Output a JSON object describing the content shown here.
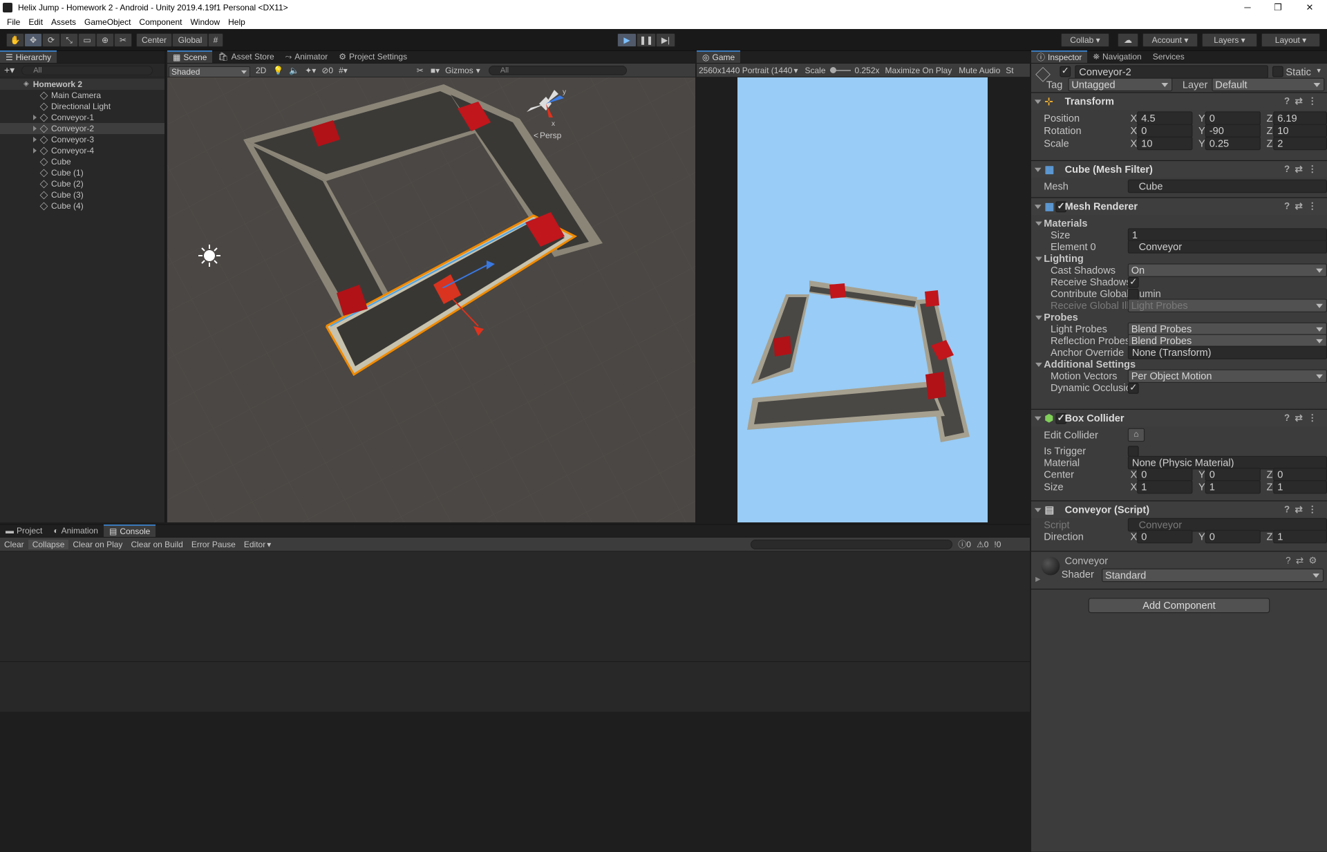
{
  "window": {
    "title": "Helix Jump - Homework 2 - Android - Unity 2019.4.19f1 Personal <DX11>",
    "minimize": "─",
    "maximize": "❐",
    "close": "✕"
  },
  "menu": [
    "File",
    "Edit",
    "Assets",
    "GameObject",
    "Component",
    "Window",
    "Help"
  ],
  "toolbar": {
    "pivot": "Center",
    "space": "Global",
    "collab": "Collab",
    "account": "Account",
    "layers": "Layers",
    "layout": "Layout"
  },
  "hierarchy": {
    "tab": "Hierarchy",
    "search_placeholder": "All",
    "scene": "Homework 2",
    "items": [
      {
        "label": "Main Camera",
        "has_children": false,
        "selected": false
      },
      {
        "label": "Directional Light",
        "has_children": false,
        "selected": false
      },
      {
        "label": "Conveyor-1",
        "has_children": true,
        "selected": false
      },
      {
        "label": "Conveyor-2",
        "has_children": true,
        "selected": true
      },
      {
        "label": "Conveyor-3",
        "has_children": true,
        "selected": false
      },
      {
        "label": "Conveyor-4",
        "has_children": true,
        "selected": false
      },
      {
        "label": "Cube",
        "has_children": false,
        "selected": false
      },
      {
        "label": "Cube (1)",
        "has_children": false,
        "selected": false
      },
      {
        "label": "Cube (2)",
        "has_children": false,
        "selected": false
      },
      {
        "label": "Cube (3)",
        "has_children": false,
        "selected": false
      },
      {
        "label": "Cube (4)",
        "has_children": false,
        "selected": false
      }
    ]
  },
  "scene_view": {
    "tabs": [
      "Scene",
      "Asset Store",
      "Animator",
      "Project Settings"
    ],
    "shading": "Shaded",
    "mode_2d": "2D",
    "hidden_count": "0",
    "gizmos": "Gizmos",
    "search_placeholder": "All",
    "persp_label": "Persp",
    "gizmo_x": "x",
    "gizmo_y": "y"
  },
  "game_view": {
    "tab": "Game",
    "resolution": "2560x1440 Portrait (1440",
    "scale_label": "Scale",
    "scale_value": "0.252x",
    "maximize": "Maximize On Play",
    "mute": "Mute Audio",
    "stats": "St",
    "sky_color": "#99ccf6"
  },
  "console": {
    "tabs": [
      "Project",
      "Animation",
      "Console"
    ],
    "buttons": [
      "Clear",
      "Collapse",
      "Clear on Play",
      "Clear on Build",
      "Error Pause",
      "Editor"
    ],
    "counts": {
      "log": "0",
      "warn": "0",
      "error": "0"
    }
  },
  "inspector": {
    "tabs": [
      "Inspector",
      "Navigation",
      "Services"
    ],
    "object_name": "Conveyor-2",
    "static_label": "Static",
    "tag_label": "Tag",
    "tag_value": "Untagged",
    "layer_label": "Layer",
    "layer_value": "Default",
    "transform": {
      "title": "Transform",
      "position": {
        "label": "Position",
        "x": "4.5",
        "y": "0",
        "z": "6.19"
      },
      "rotation": {
        "label": "Rotation",
        "x": "0",
        "y": "-90",
        "z": "10"
      },
      "scale": {
        "label": "Scale",
        "x": "10",
        "y": "0.25",
        "z": "2"
      }
    },
    "mesh_filter": {
      "title": "Cube (Mesh Filter)",
      "mesh_label": "Mesh",
      "mesh_value": "Cube"
    },
    "mesh_renderer": {
      "title": "Mesh Renderer",
      "materials": "Materials",
      "size_label": "Size",
      "size_value": "1",
      "element0_label": "Element 0",
      "element0_value": "Conveyor",
      "lighting": "Lighting",
      "cast_shadows_label": "Cast Shadows",
      "cast_shadows_value": "On",
      "receive_shadows_label": "Receive Shadows",
      "contribute_gi_label": "Contribute Global Illumin",
      "receive_gi_label": "Receive Global Illuminati",
      "receive_gi_value": "Light Probes",
      "probes": "Probes",
      "light_probes_label": "Light Probes",
      "light_probes_value": "Blend Probes",
      "reflection_probes_label": "Reflection Probes",
      "reflection_probes_value": "Blend Probes",
      "anchor_override_label": "Anchor Override",
      "anchor_override_value": "None (Transform)",
      "additional": "Additional Settings",
      "motion_vectors_label": "Motion Vectors",
      "motion_vectors_value": "Per Object Motion",
      "dynamic_occlusion_label": "Dynamic Occlusion"
    },
    "box_collider": {
      "title": "Box Collider",
      "edit_collider": "Edit Collider",
      "is_trigger": "Is Trigger",
      "material_label": "Material",
      "material_value": "None (Physic Material)",
      "center": {
        "label": "Center",
        "x": "0",
        "y": "0",
        "z": "0"
      },
      "size": {
        "label": "Size",
        "x": "1",
        "y": "1",
        "z": "1"
      }
    },
    "conveyor_script": {
      "title": "Conveyor (Script)",
      "script_label": "Script",
      "script_value": "Conveyor",
      "direction": {
        "label": "Direction",
        "x": "0",
        "y": "0",
        "z": "1"
      }
    },
    "material": {
      "name": "Conveyor",
      "shader_label": "Shader",
      "shader_value": "Standard"
    },
    "add_component": "Add Component"
  },
  "axis": {
    "x": "X",
    "y": "Y",
    "z": "Z"
  },
  "colors": {
    "accent": "#3a79bb",
    "selection_outline": "#f08a00",
    "red_cube": "#c0161c"
  }
}
